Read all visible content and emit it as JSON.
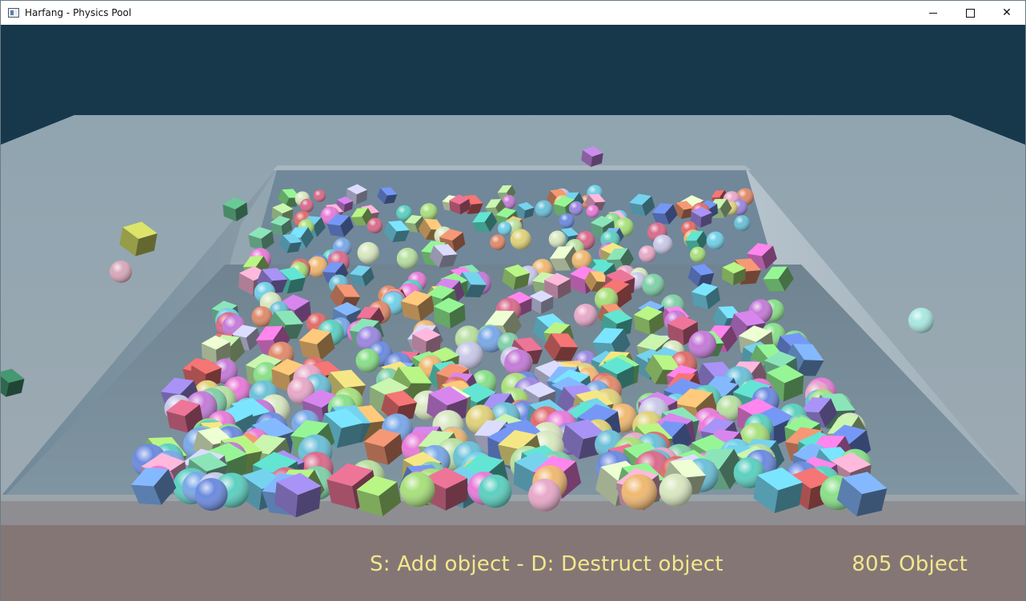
{
  "window": {
    "title": "Harfang - Physics Pool",
    "buttons": {
      "minimize": "",
      "maximize": "",
      "close": "✕"
    }
  },
  "hud": {
    "help": "S: Add object - D: Destruct object",
    "count": "805 Object"
  },
  "colors": {
    "sky": "#16384a",
    "floor": "#8a8f96",
    "pool_rim": "#9ea9b2",
    "hud_text": "#f2e88a",
    "foreground_band": "#857676"
  },
  "icons": {
    "app": "window-app-icon",
    "minimize": "minimize-icon",
    "maximize": "maximize-icon",
    "close": "close-icon"
  }
}
